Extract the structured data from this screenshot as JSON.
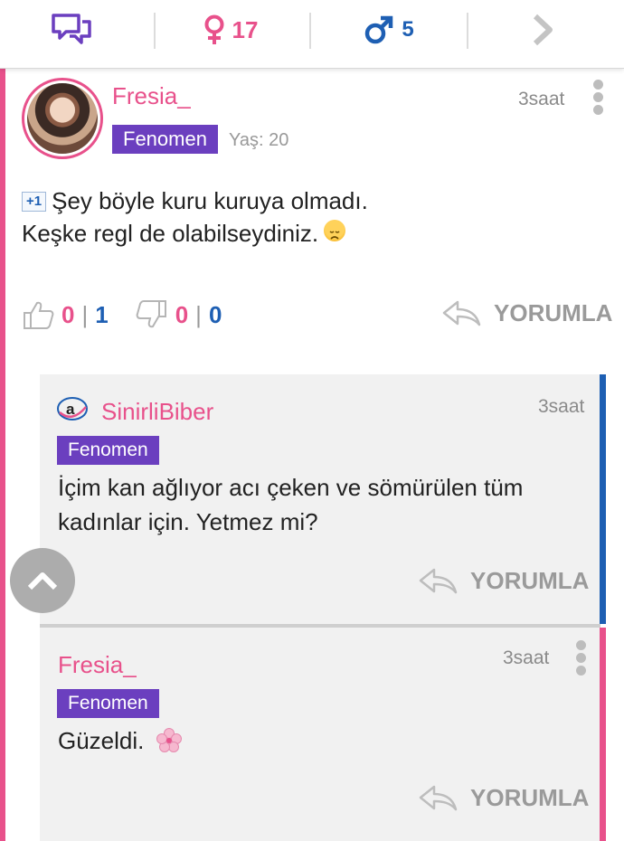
{
  "topbar": {
    "ghost_text": "",
    "female_count": "17",
    "male_count": "5",
    "icons": [
      "chat-bubbles-icon",
      "female-icon",
      "male-icon",
      "chevron-right-icon"
    ]
  },
  "colors": {
    "pink": "#e8518b",
    "blue": "#1e5fb3",
    "purple": "#6b3fbf",
    "gray": "#9a9a9a"
  },
  "comment": {
    "username": "Fresia_",
    "badge": "Fenomen",
    "age": "Yaş: 20",
    "time": "3saat",
    "plus_one": "+1",
    "line1": "Şey böyle kuru kuruya olmadı.",
    "line2": "Keşke regl de olabilseydiniz.",
    "emoji": "disappointed-face",
    "likes": "0",
    "likes_total": "1",
    "dislikes": "0",
    "dislikes_total": "0",
    "reply_label": "YORUMLA"
  },
  "replies": [
    {
      "username": "SinirliBiber",
      "badge": "Fenomen",
      "time": "3saat",
      "line1": "İçim kan ağlıyor acı çeken ve sömürülen tüm",
      "line2": "kadınlar için. Yetmez mi?",
      "reply_label": "YORUMLA",
      "bar_color": "#1e5fb3"
    },
    {
      "username": "Fresia_",
      "badge": "Fenomen",
      "time": "3saat",
      "line1": "Güzeldi.",
      "emoji": "cherry-blossom",
      "reply_label": "YORUMLA",
      "bar_color": "#e8518b"
    }
  ]
}
